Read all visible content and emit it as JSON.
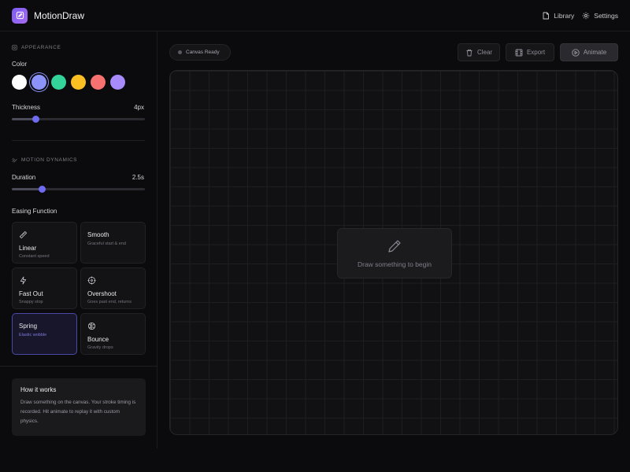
{
  "header": {
    "app_title": "MotionDraw",
    "library_label": "Library",
    "settings_label": "Settings"
  },
  "sidebar": {
    "appearance": {
      "section_title": "APPEARANCE",
      "color_label": "Color",
      "colors": [
        "#ffffff",
        "#8b93f8",
        "#34d399",
        "#fbbf24",
        "#f87171",
        "#a78bfa"
      ],
      "selected_color_index": 1,
      "thickness_label": "Thickness",
      "thickness_value": "4px",
      "thickness_fraction": 0.18
    },
    "motion": {
      "section_title": "MOTION DYNAMICS",
      "duration_label": "Duration",
      "duration_value": "2.5s",
      "duration_fraction": 0.23,
      "easing_label": "Easing Function",
      "easings": [
        {
          "name": "Linear",
          "desc": "Constant speed",
          "icon": "ruler-icon"
        },
        {
          "name": "Smooth",
          "desc": "Graceful start & end",
          "icon": ""
        },
        {
          "name": "Fast Out",
          "desc": "Snappy stop",
          "icon": "lightning-icon"
        },
        {
          "name": "Overshoot",
          "desc": "Goes past end, returns",
          "icon": "crosshair-icon"
        },
        {
          "name": "Spring",
          "desc": "Elastic wobble",
          "icon": ""
        },
        {
          "name": "Bounce",
          "desc": "Gravity drops",
          "icon": "ball-icon"
        }
      ],
      "selected_easing_index": 4
    },
    "info": {
      "title": "How it works",
      "text": "Draw something on the canvas. Your stroke timing is recorded. Hit animate to replay it with custom physics."
    }
  },
  "main": {
    "status": "Canvas Ready",
    "clear_label": "Clear",
    "export_label": "Export",
    "animate_label": "Animate",
    "empty_text": "Draw something to begin"
  },
  "colors": {
    "accent": "#6f6bf0",
    "background": "#0b0b0d"
  }
}
